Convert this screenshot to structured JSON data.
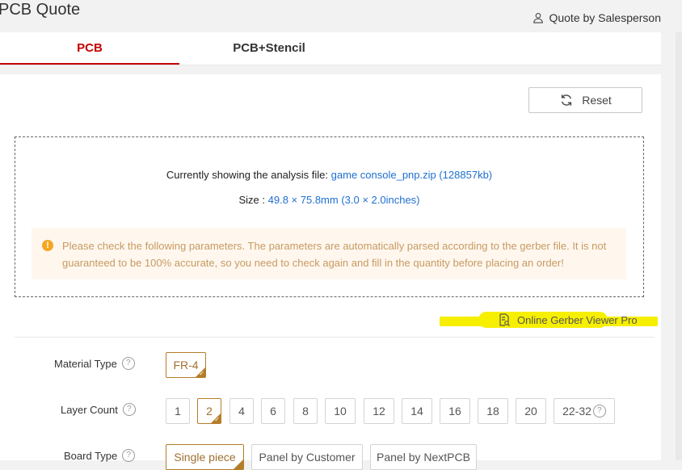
{
  "header": {
    "title": "PCB Quote",
    "quote_by_salesperson": "Quote by Salesperson"
  },
  "tabs": [
    {
      "label": "PCB"
    },
    {
      "label": "PCB+Stencil"
    }
  ],
  "reset_label": "Reset",
  "analysis": {
    "file_prefix": "Currently showing the analysis file:",
    "file_name": "game console_pnp.zip (128857kb)",
    "size_prefix": "Size :",
    "size_value": "49.8 × 75.8mm (3.0 × 2.0inches)"
  },
  "warning_text": "Please check the following parameters. The parameters are automatically parsed according to the gerber file. It is not guaranteed to be 100% accurate, so you need to check again and fill in the quantity before placing an order!",
  "gerber_viewer_label": "Online Gerber Viewer Pro",
  "params": {
    "material": {
      "label": "Material Type",
      "options": [
        "FR-4"
      ],
      "selected": "FR-4"
    },
    "layer": {
      "label": "Layer Count",
      "options": [
        "1",
        "2",
        "4",
        "6",
        "8",
        "10",
        "12",
        "14",
        "16",
        "18",
        "20",
        "22-32"
      ],
      "selected": "2"
    },
    "board": {
      "label": "Board Type",
      "options": [
        "Single piece",
        "Panel by Customer",
        "Panel by NextPCB"
      ],
      "selected": "Single piece"
    }
  },
  "colors": {
    "accent_red": "#c40000",
    "link_blue": "#1f6fd1",
    "option_selected": "#b47d2a",
    "highlight_yellow": "#f6ef00",
    "warning_bg": "#fff7ee"
  }
}
